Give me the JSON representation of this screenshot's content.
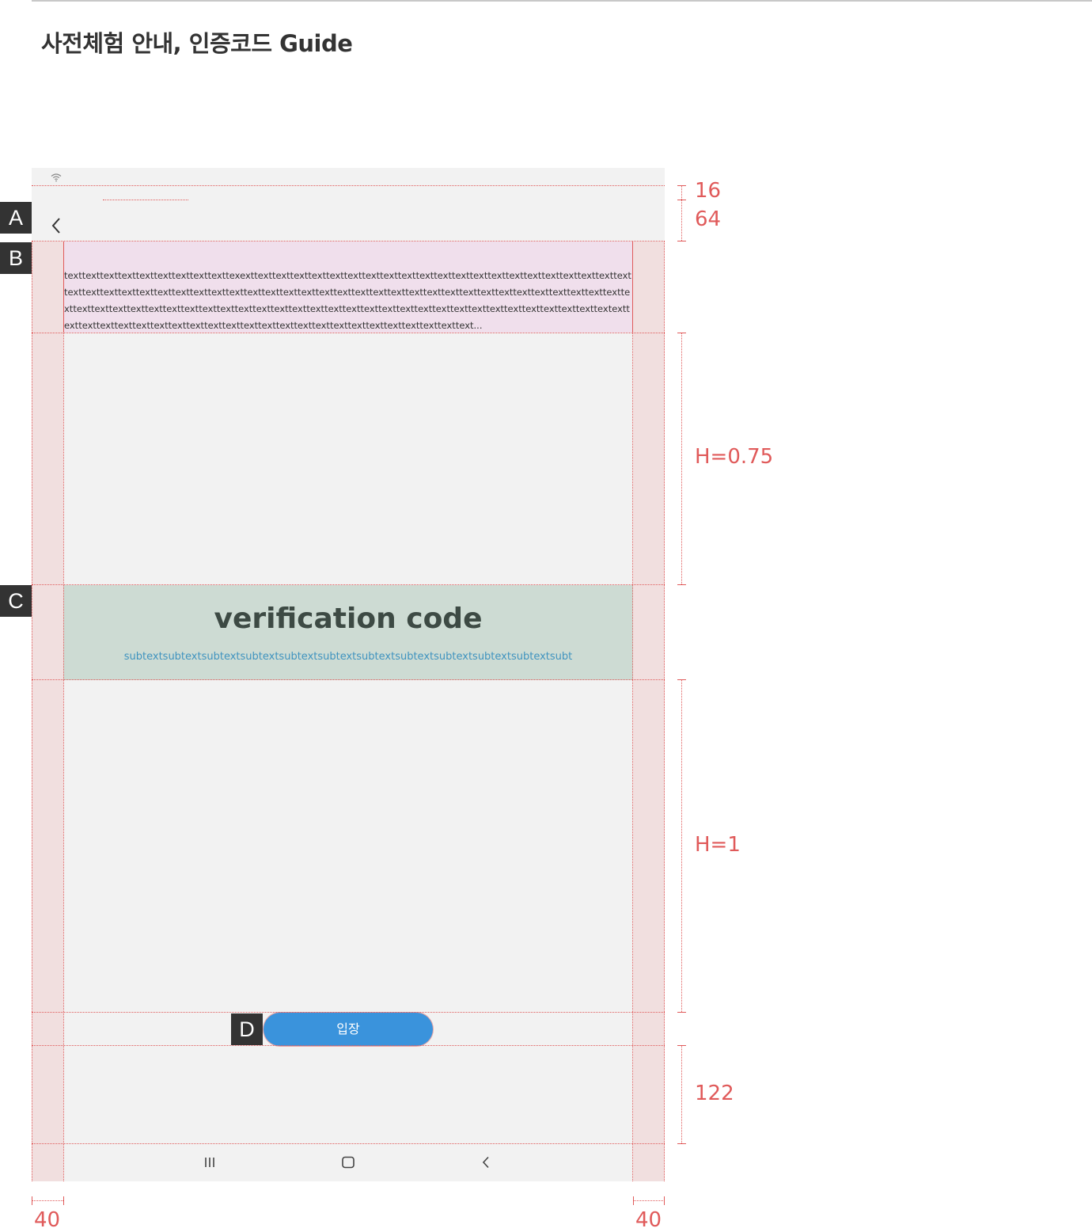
{
  "page": {
    "title": "사전체험 안내, 인증코드 Guide"
  },
  "badges": [
    "A",
    "B",
    "C",
    "D"
  ],
  "content": {
    "body_text": "texttexttexttexttexttexttexttexttexttexexttexttexttexttexttexttexttexttexttexttexttexttexttexttexttexttexttexttexttexttexttexttexttexttexttexttexttexttexttexttexttexttexttexttexttexttexttexttexttexttexttexttexttexttexttexttexttexttexttexttexttexttexttexttexttexttexttexttexttexttexttexttexttexttexttexttexttexttexttexttexttexttexttexttexttexttexttexttexttexttexttexttexttextexttexttexttexttexttexttexttexttexttexttexttexttexttexttexttexttexttexttexttexttexttexttexttext...",
    "code_title": "verification code",
    "code_subtext": "subtextsubtextsubtextsubtextsubtextsubtextsubtextsubtextsubtextsubtextsubtextsubt",
    "enter_button_label": "입장"
  },
  "annotations": {
    "status_bar_height": "16",
    "app_bar_height": "64",
    "top_space_ratio": "H=0.75",
    "bottom_space_ratio": "H=1",
    "bottom_space_height": "122",
    "left_margin": "40",
    "right_margin": "40"
  },
  "icons": {
    "status": "wifi-icon",
    "app_bar": "back-arrow-icon",
    "nav": [
      "recents-icon",
      "home-icon",
      "back-icon"
    ]
  },
  "colors": {
    "accent_button": "#3a93dc",
    "guide_red": "#e05a5a",
    "region_b_bg": "#f0dfec",
    "region_c_bg": "#cddbd3",
    "subtext": "#3f93bf"
  }
}
